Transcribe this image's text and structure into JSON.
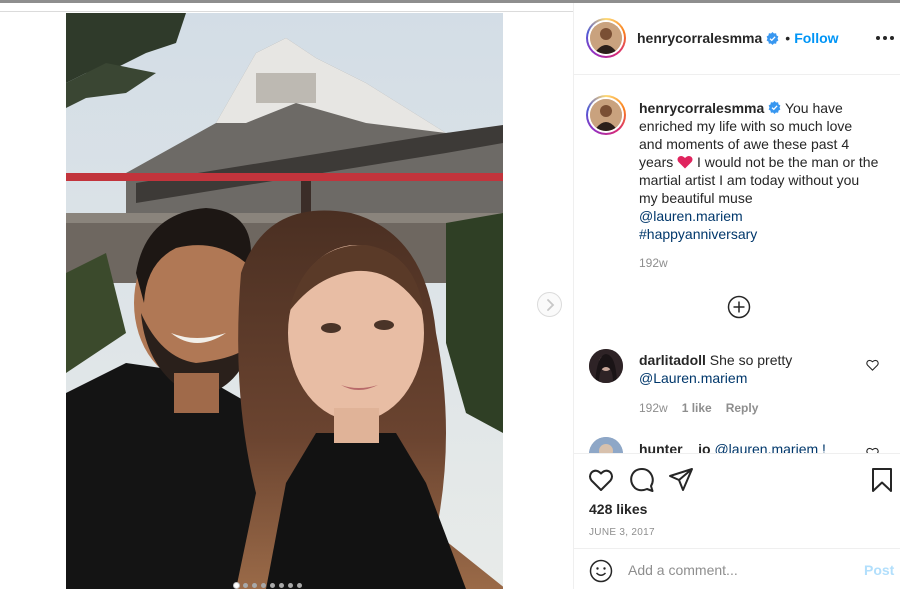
{
  "post": {
    "username": "henrycorralesmma",
    "follow_label": "Follow",
    "bullet": "•",
    "caption": {
      "text_part1": "You have enriched my life with so much love and moments of awe these past 4 years",
      "text_part2": "I would not be the man or the martial artist I am today without you my beautiful muse",
      "mention": "@lauren.mariem",
      "hashtag": "#happyanniversary",
      "time": "192w"
    },
    "likes": "428 likes",
    "date": "JUNE 3, 2017",
    "carousel": {
      "total_slides": 8,
      "active_index": 0
    }
  },
  "comments": [
    {
      "username": "darlitadoll",
      "text": "She so pretty",
      "mention": "@Lauren.mariem",
      "time": "192w",
      "likes": "1 like",
      "reply_label": "Reply"
    },
    {
      "username": "hunter__jo",
      "text": "@lauren.mariem !",
      "mention": "",
      "time": "",
      "likes": "",
      "reply_label": ""
    }
  ],
  "add_comment": {
    "placeholder": "Add a comment...",
    "post_label": "Post"
  },
  "colors": {
    "accent": "#0095f6",
    "verified": "#3897f0",
    "heart": "#e0245e",
    "text": "#262626",
    "muted": "#8e8e8e"
  },
  "icons": [
    "verified-badge-icon",
    "more-options-icon",
    "chevron-right-icon",
    "heart-icon",
    "comment-icon",
    "share-icon",
    "bookmark-icon",
    "emoji-icon",
    "plus-circle-icon"
  ]
}
